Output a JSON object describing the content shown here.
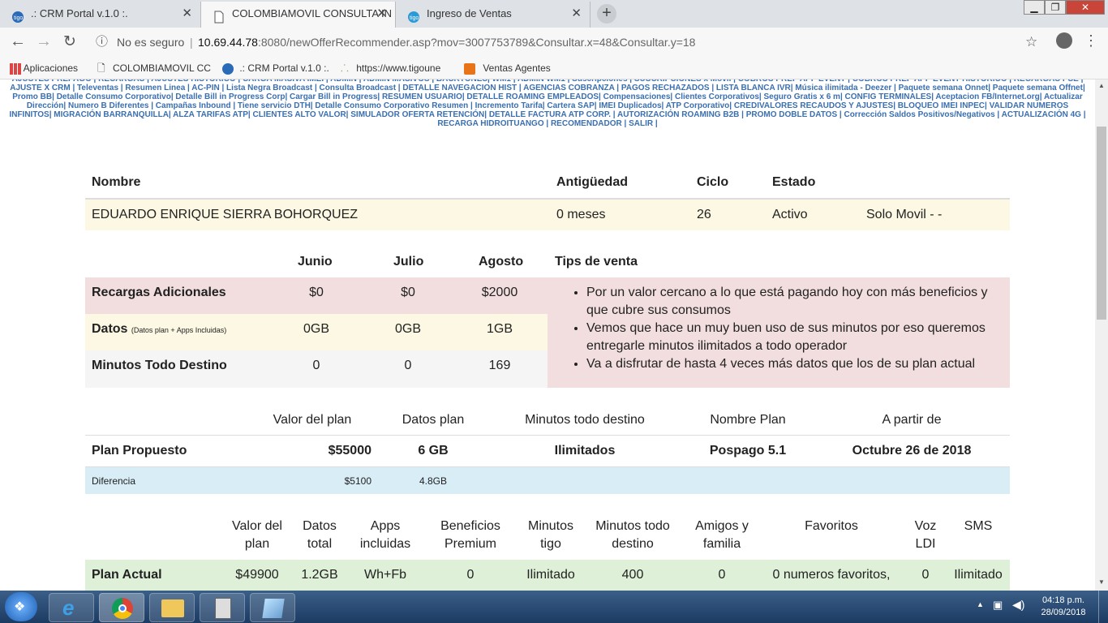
{
  "browser": {
    "tabs": [
      {
        "title": ".: CRM Portal v.1.0 :.",
        "active": false
      },
      {
        "title": "COLOMBIAMOVIL CONSULTA IN",
        "active": true
      },
      {
        "title": "Ingreso de Ventas",
        "active": false
      }
    ],
    "security_label": "No es seguro",
    "url_host": "10.69.44.78",
    "url_rest": ":8080/newOfferRecommender.asp?mov=3007753789&Consultar.x=48&Consultar.y=18",
    "bookmarks": [
      "Aplicaciones",
      "COLOMBIAMOVIL CC",
      ".: CRM Portal v.1.0 :.",
      "https://www.tigoune",
      "Ventas Agentes"
    ]
  },
  "nav_links_text": "AJUSTES PREPAGO | RECARGAS | AJUSTES HISTORICO | CARGA MASIVA IMEI | ADMIN | ADMIN MASIVOS | BACKTONES| WM1 | ADMIN WM1 | Suscripciones | SUSCRIPCIONES x Movil | COBROS PREP APP EVENT | COBROS PREP APP EVENT HISTORICO | RECARGAS PSE | AJUSTE X CRM | Televentas | Resumen Linea | AC-PIN | Lista Negra Broadcast | Consulta Broadcast | DETALLE NAVEGACION HIST | AGENCIAS COBRANZA | PAGOS RECHAZADOS | LISTA BLANCA IVR| Música ilimitada - Deezer | Paquete semana Onnet| Paquete semana Offnet| Promo BB| Detalle Consumo Corporativo| Detalle Bill in Progress Corp| Cargar Bill in Progress| RESUMEN USUARIO| DETALLE ROAMING EMPLEADOS| Compensaciones| Clientes Corporativos| Seguro Gratis x 6 m| CONFIG TERMINALES| Aceptacion FB/Internet.org| Actualizar Dirección| Numero B Diferentes | Campañas Inbound | Tiene servicio DTH| Detalle Consumo Corporativo Resumen | Incremento Tarifa| Cartera SAP| IMEI Duplicados| ATP Corporativo| CREDIVALORES RECAUDOS Y AJUSTES| BLOQUEO IMEI INPEC| VALIDAR NUMEROS INFINITOS| MIGRACIÓN BARRANQUILLA| ALZA TARIFAS ATP| CLIENTES ALTO VALOR| SIMULADOR OFERTA RETENCIÓN| DETALLE FACTURA ATP CORP. | AUTORIZACIÓN ROAMING B2B | PROMO DOBLE DATOS | Corrección Saldos Positivos/Negativos | ACTUALIZACIÓN 4G | RECARGA HIDROITUANGO | RECOMENDADOR | SALIR |",
  "customer": {
    "headers": {
      "nombre": "Nombre",
      "antiguedad": "Antigüedad",
      "ciclo": "Ciclo",
      "estado": "Estado"
    },
    "nombre": "EDUARDO ENRIQUE SIERRA BOHORQUEZ",
    "antiguedad": "0 meses",
    "ciclo": "26",
    "estado": "Activo",
    "tipo": "Solo Movil - -"
  },
  "consumo": {
    "months": [
      "Junio",
      "Julio",
      "Agosto"
    ],
    "tips_header": "Tips de venta",
    "rows": [
      {
        "label": "Recargas Adicionales",
        "sub": "",
        "values": [
          "$0",
          "$0",
          "$2000"
        ]
      },
      {
        "label": "Datos",
        "sub": "(Datos plan + Apps Incluidas)",
        "values": [
          "0GB",
          "0GB",
          "1GB"
        ]
      },
      {
        "label": "Minutos Todo Destino",
        "sub": "",
        "values": [
          "0",
          "0",
          "169"
        ]
      }
    ],
    "tips": [
      "Por un valor cercano a lo que está pagando hoy con más beneficios y que cubre sus consumos",
      "Vemos que hace un muy buen uso de sus minutos por eso queremos entregarle minutos ilimitados a todo operador",
      "Va a disfrutar de hasta 4 veces más datos que los de su plan actual"
    ]
  },
  "propuesto": {
    "headers": [
      "Valor del plan",
      "Datos plan",
      "Minutos todo destino",
      "Nombre Plan",
      "A partir de"
    ],
    "row_label": "Plan Propuesto",
    "valor": "$55000",
    "datos": "6 GB",
    "minutos": "Ilimitados",
    "nombre_plan": "Pospago 5.1",
    "desde": "Octubre 26 de 2018",
    "diff_label": "Diferencia",
    "diff_valor": "$5100",
    "diff_datos": "4.8GB"
  },
  "actual": {
    "headers": [
      [
        "Valor del",
        "plan"
      ],
      [
        "Datos",
        "total"
      ],
      [
        "Apps",
        "incluidas"
      ],
      [
        "Beneficios",
        "Premium"
      ],
      [
        "Minutos",
        "tigo"
      ],
      [
        "Minutos todo",
        "destino"
      ],
      [
        "Amigos y",
        "familia"
      ],
      [
        "Favoritos",
        ""
      ],
      [
        "Voz",
        "LDI"
      ],
      [
        "SMS",
        ""
      ]
    ],
    "row_label": "Plan Actual",
    "values": [
      "$49900",
      "1.2GB",
      "Wh+Fb",
      "0",
      "Ilimitado",
      "400",
      "0",
      "0 numeros favoritos,",
      "0",
      "Ilimitado"
    ]
  },
  "taskbar": {
    "time": "04:18 p.m.",
    "date": "28/09/2018"
  },
  "colors": {
    "recargas_bg": "#f2dede",
    "datos_bg": "#fcf8e3",
    "minutos_bg": "#f5f5f5",
    "tips_bg": "#f2dede",
    "diferencia_bg": "#d9edf7",
    "plan_actual_bg": "#dff0d8",
    "customer_row_bg": "#fcf8e3",
    "link_color": "#3a6fb0"
  }
}
